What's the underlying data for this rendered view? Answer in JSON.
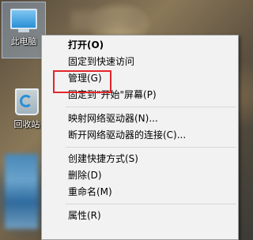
{
  "desktop": {
    "this_pc_label": "此电脑",
    "recycle_bin_label": "回收站"
  },
  "context_menu": {
    "items": [
      {
        "label": "打开(O)",
        "bold": true
      },
      {
        "label": "固定到快速访问"
      },
      {
        "label": "管理(G)",
        "highlighted": true
      },
      {
        "label": "固定到\"开始\"屏幕(P)"
      },
      {
        "separator": true
      },
      {
        "label": "映射网络驱动器(N)..."
      },
      {
        "label": "断开网络驱动器的连接(C)..."
      },
      {
        "separator": true
      },
      {
        "label": "创建快捷方式(S)"
      },
      {
        "label": "删除(D)"
      },
      {
        "label": "重命名(M)"
      },
      {
        "separator": true
      },
      {
        "label": "属性(R)"
      }
    ]
  },
  "colors": {
    "menu_background": "#f2f2f2",
    "highlight_border": "#e2262b"
  }
}
